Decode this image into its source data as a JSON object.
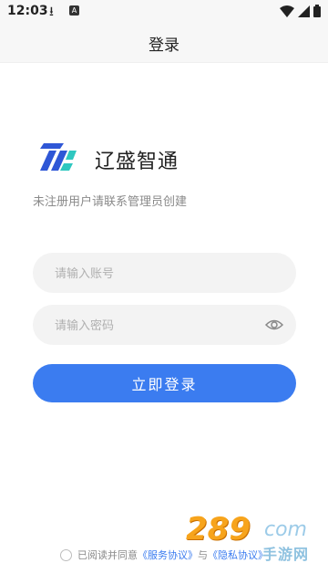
{
  "status_bar": {
    "time": "12:03",
    "icons": [
      "download-icon",
      "a-icon",
      "wifi-icon",
      "signal-icon",
      "battery-icon"
    ]
  },
  "app_bar": {
    "title": "登录"
  },
  "brand": {
    "name": "辽盛智通",
    "logo": "brand-logo-icon"
  },
  "tip": "未注册用户请联系管理员创建",
  "form": {
    "account_placeholder": "请输入账号",
    "password_placeholder": "请输入密码",
    "login_label": "立即登录"
  },
  "agreement": {
    "prefix": "已阅读并同意",
    "service_link": "《服务协议》",
    "and": "与",
    "privacy_link": "《隐私协议》"
  },
  "watermark": {
    "num": "289",
    "com": "com",
    "cn": "手游网"
  },
  "colors": {
    "primary": "#3b7cf0",
    "logo_blue": "#2f57d6",
    "logo_teal": "#2fc7c0"
  }
}
